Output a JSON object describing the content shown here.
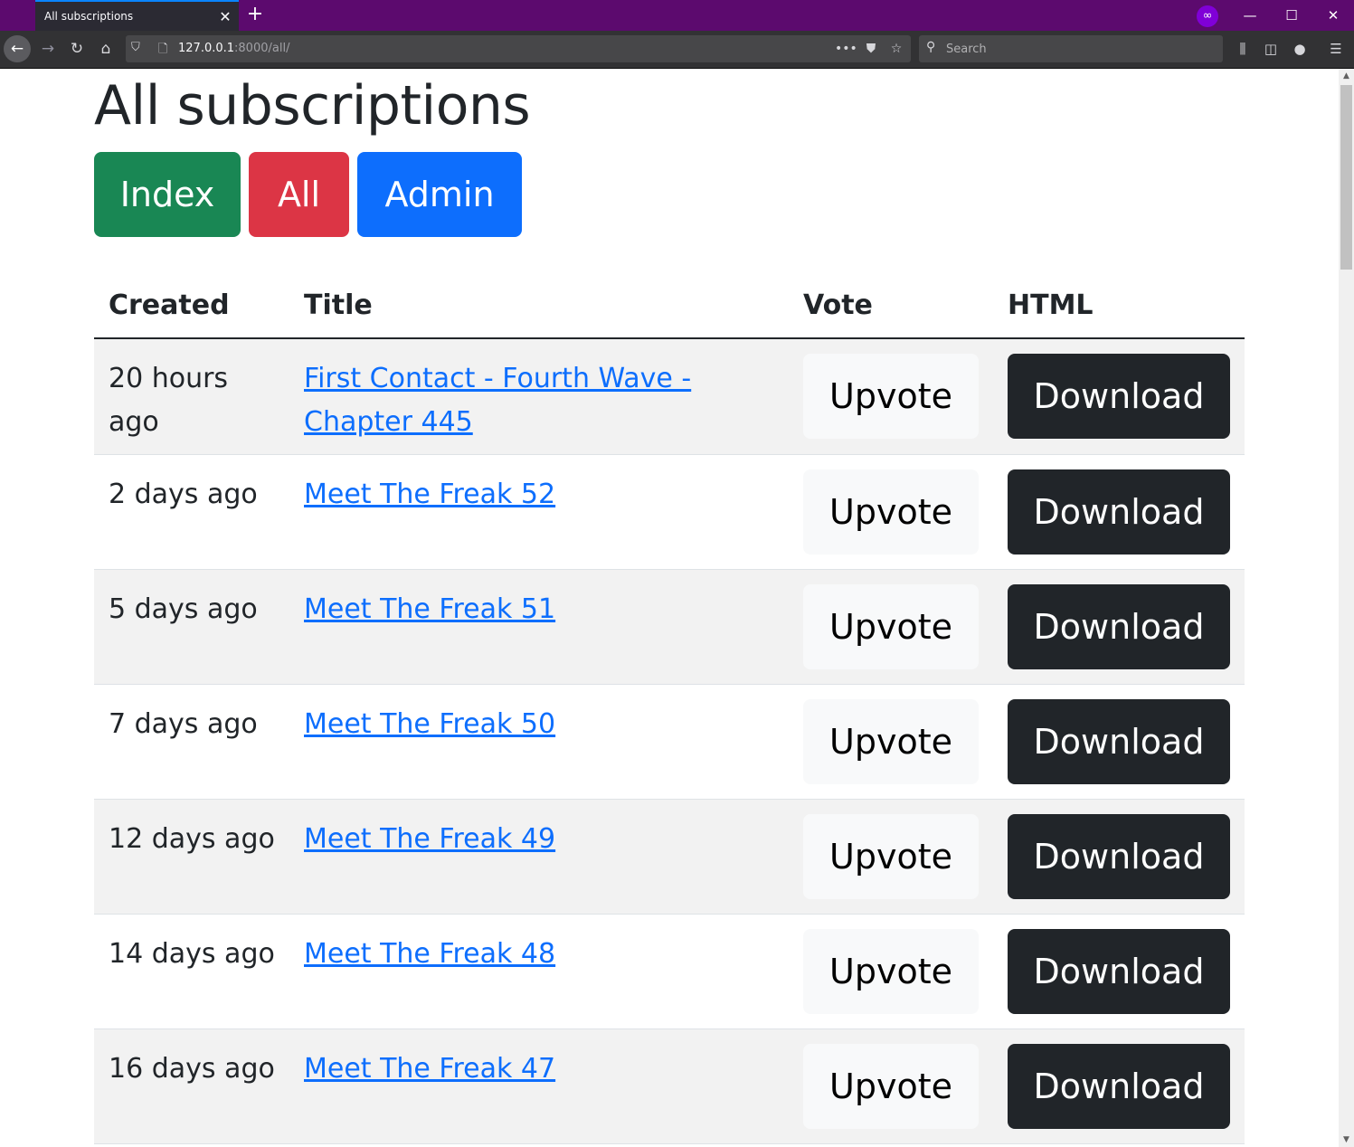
{
  "browser": {
    "tab_title": "All subscriptions",
    "tab_close": "✕",
    "new_tab": "+",
    "url_host": "127.0.0.1",
    "url_rest": ":8000/all/",
    "search_placeholder": "Search",
    "private_icon": "∞",
    "window_minimize": "—",
    "window_maximize": "☐",
    "window_close": "✕"
  },
  "page": {
    "heading": "All subscriptions",
    "nav_buttons": {
      "index": "Index",
      "all": "All",
      "admin": "Admin"
    },
    "nav_colors": {
      "index": "#198754",
      "all": "#dc3545",
      "admin": "#0d6efd"
    },
    "table": {
      "headers": [
        "Created",
        "Title",
        "Vote",
        "HTML"
      ],
      "rows": [
        {
          "created": "20 hours ago",
          "title": "First Contact - Fourth Wave - Chapter 445",
          "vote": "Upvote",
          "html": "Download"
        },
        {
          "created": "2 days ago",
          "title": "Meet The Freak 52",
          "vote": "Upvote",
          "html": "Download"
        },
        {
          "created": "5 days ago",
          "title": "Meet The Freak 51",
          "vote": "Upvote",
          "html": "Download"
        },
        {
          "created": "7 days ago",
          "title": "Meet The Freak 50",
          "vote": "Upvote",
          "html": "Download"
        },
        {
          "created": "12 days ago",
          "title": "Meet The Freak 49",
          "vote": "Upvote",
          "html": "Download"
        },
        {
          "created": "14 days ago",
          "title": "Meet The Freak 48",
          "vote": "Upvote",
          "html": "Download"
        },
        {
          "created": "16 days ago",
          "title": "Meet The Freak 47",
          "vote": "Upvote",
          "html": "Download"
        }
      ]
    }
  }
}
